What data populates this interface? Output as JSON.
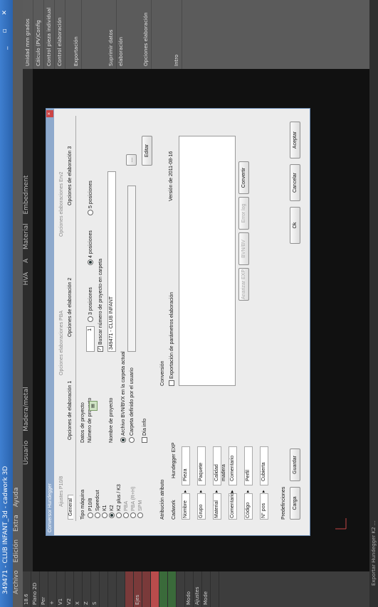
{
  "window": {
    "title": "349471 - CLUB INFANT_3d - cadwork 3D"
  },
  "menu": [
    "Archivo",
    "Edición",
    "Extra",
    "Ayuda"
  ],
  "win_controls": "_ ▫ ✕",
  "viewport_tabs": [
    "Usuario",
    "Madera/metal",
    "HVA",
    "A",
    "Material",
    "Embedment"
  ],
  "left_tools": [
    "18.6",
    "Plano 2D",
    "Per",
    "+",
    "V1",
    "V2",
    "X",
    "Z",
    "S",
    "",
    "",
    "",
    "",
    "Ejes",
    "",
    "",
    "",
    "",
    "",
    "Modo",
    "Ajustes",
    "Mode",
    ""
  ],
  "right_panel": {
    "items": [
      "Unidad",
      "Cálculo (PV)Config",
      "Control pieza individual",
      "Control elaboración"
    ],
    "sections": [
      "Exportación",
      "Suprimir datos elaboración",
      "Opciones elaboración",
      "Intro"
    ],
    "unit_value": "mm grados"
  },
  "status_bar": "Exportar Hundegger K2 ...",
  "dialog": {
    "title": "Conversor Hundegger",
    "top_tabs": [
      "Ajustes P10/8",
      "Opciones elaboraciones PBA",
      "Opciones elaboraciones Erv2"
    ],
    "sub_tabs": [
      "General",
      "Opciones de elaboración 1",
      "Opciones de elaboración 2",
      "Opciones de elaboración 3"
    ],
    "machine_type_label": "Tipo máquina",
    "machines": [
      "P10/8",
      "Speedcut",
      "K1",
      "K2",
      "K2 plus / K3",
      "PBA",
      "PBA (R+H)",
      "SPM"
    ],
    "machine_selected": "K2",
    "project_data_label": "Datos de proyecto",
    "project_number_label": "Número de proyecto",
    "project_number_value": "1",
    "search_project_number": "Buscar número de proyecto en carpeta",
    "positions_label_a": "3 posiciones",
    "positions_label_b": "4 posiciones",
    "positions_label_c": "5 posiciones",
    "project_name_label": "Nombre de proyecto",
    "project_name_value": "349471 - CLUB INFANT",
    "file_option_a": "Archivo BVN/BVX en la carpeta actual",
    "file_option_b": "Carpeta definido por el usuario",
    "day_info": "Día info",
    "edit_button": "Editar",
    "conversion_label": "Conversión",
    "export_params": "Exportación de parámetros elaboración",
    "version": "Versión de 2011-08-16",
    "attribute_label": "Atribución atributo",
    "col_cadwork": "Cadwork",
    "col_hundegger": "Hundegger EXP",
    "attribute_rows": [
      {
        "cad": "Nombre",
        "hun": "Pieza"
      },
      {
        "cad": "Grupo",
        "hun": "Paquete"
      },
      {
        "cad": "Material",
        "hun": "Calidad madera"
      },
      {
        "cad": "Comentario",
        "hun": "Comentario"
      },
      {
        "cad": "Código",
        "hun": "Perfil"
      },
      {
        "cad": "N° pos",
        "hun": "Cubierta"
      }
    ],
    "defaults_label": "Predefinciones",
    "load_button": "Carga",
    "save_button": "Guardar",
    "analyze_button": "Anarizar EXP",
    "bvn_button": "BVN/BV",
    "error_button": "Error log",
    "convert_button": "Convertir",
    "ok_button": "Ok",
    "cancel_button": "Cancelar",
    "accept_button": "Aceptar"
  }
}
